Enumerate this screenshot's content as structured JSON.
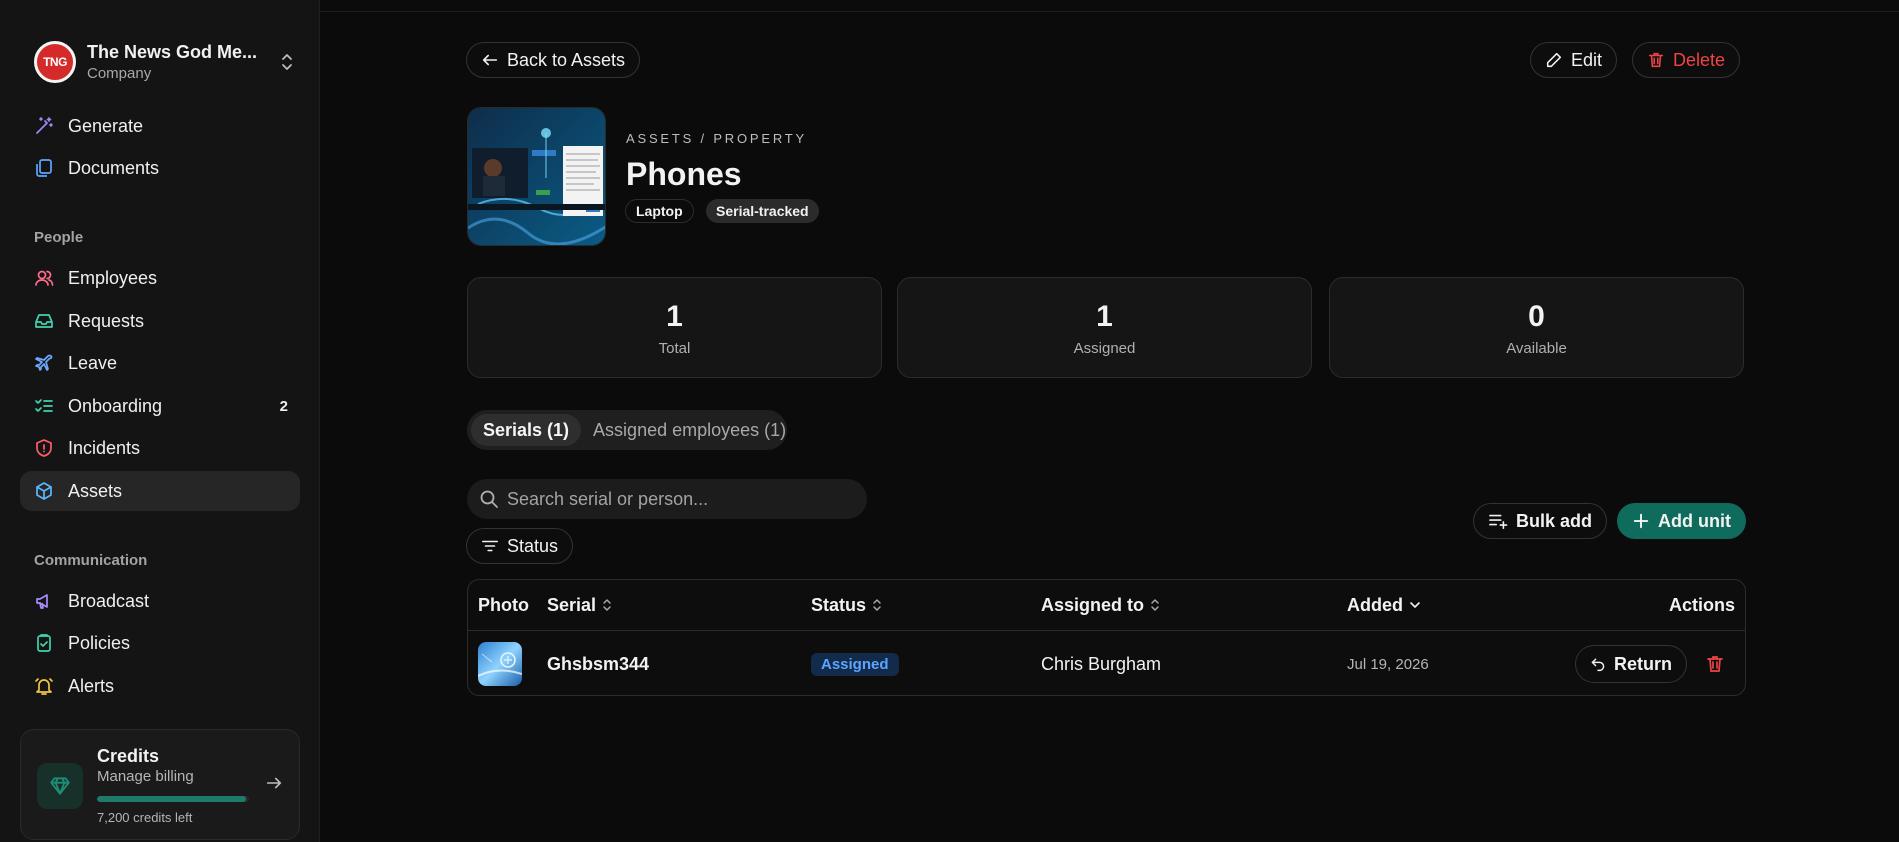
{
  "org": {
    "logo_text": "TNG",
    "name": "The News God Me...",
    "type": "Company"
  },
  "nav": {
    "generate": "Generate",
    "documents": "Documents",
    "people_label": "People",
    "employees": "Employees",
    "requests": "Requests",
    "leave": "Leave",
    "onboarding": "Onboarding",
    "onboarding_badge": "2",
    "incidents": "Incidents",
    "assets": "Assets",
    "communication_label": "Communication",
    "broadcast": "Broadcast",
    "policies": "Policies",
    "alerts": "Alerts"
  },
  "credits": {
    "title": "Credits",
    "subtitle": "Manage billing",
    "remaining": "7,200 credits left",
    "fill_fraction": 0.98
  },
  "header": {
    "back": "Back to Assets",
    "edit": "Edit",
    "delete": "Delete"
  },
  "asset": {
    "breadcrumb": "ASSETS / PROPERTY",
    "title": "Phones",
    "tags": [
      "Laptop",
      "Serial-tracked"
    ]
  },
  "stats": [
    {
      "value": "1",
      "label": "Total"
    },
    {
      "value": "1",
      "label": "Assigned"
    },
    {
      "value": "0",
      "label": "Available"
    }
  ],
  "tabs": {
    "serials": "Serials (1)",
    "assigned": "Assigned employees (1)"
  },
  "toolbar": {
    "search_placeholder": "Search serial or person...",
    "status_filter": "Status",
    "bulk_add": "Bulk add",
    "add_unit": "Add unit"
  },
  "table": {
    "headers": {
      "photo": "Photo",
      "serial": "Serial",
      "status": "Status",
      "assigned_to": "Assigned to",
      "added": "Added",
      "actions": "Actions"
    },
    "rows": [
      {
        "serial": "Ghsbsm344",
        "status": "Assigned",
        "assigned_to": "Chris Burgham",
        "added": "Jul 19, 2026",
        "action": "Return"
      }
    ]
  },
  "colors": {
    "accent": "#0f6b5c",
    "danger": "#ef4444",
    "status_blue": "#5ea4ff"
  }
}
